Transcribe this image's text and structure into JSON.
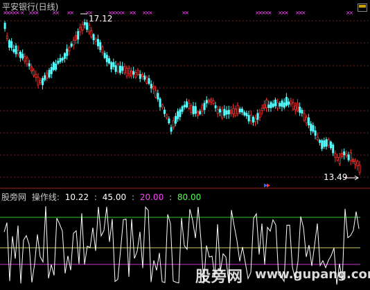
{
  "header": {
    "title": "平安银行(日线)"
  },
  "price_chart": {
    "high_label": "17.12",
    "low_label": "13.49",
    "up_color": "#ff3232",
    "down_color": "#54ffff",
    "grid_color": "#7a1f1f"
  },
  "indicator": {
    "name": "股旁网",
    "title": "操作线:",
    "value1": "10.22",
    "value2": "45.00",
    "value3": "20.00",
    "value4": "80.00",
    "color_value3": "#ff44ff",
    "color_value4": "#55ff55",
    "line_color": "#ffffff",
    "level_upper_color": "#33cc33",
    "level_mid_color": "#cccc66",
    "level_lower_color": "#cc33cc"
  },
  "watermark": {
    "text": "股旁网",
    "url": "www.gupang.com"
  },
  "icons": {
    "toggle": "window-toggle-icon",
    "signal": "x-signal-icon",
    "arrow": "blue-arrow-icon"
  }
}
